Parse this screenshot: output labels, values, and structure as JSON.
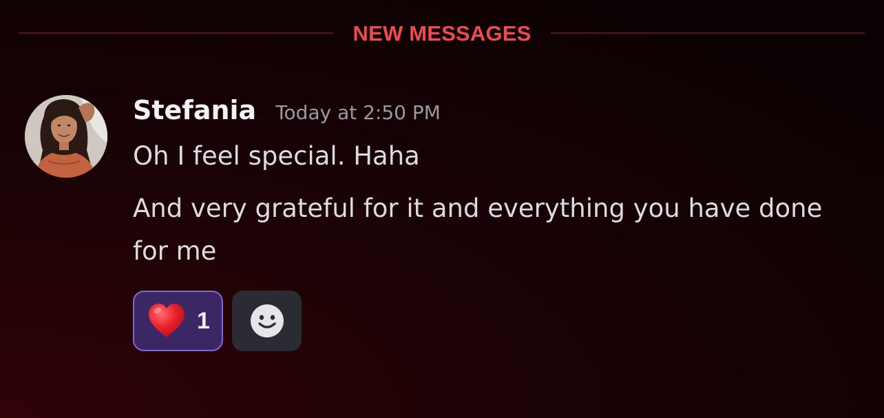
{
  "divider": {
    "label": "NEW MESSAGES"
  },
  "message": {
    "author": "Stefania",
    "timestamp": "Today at 2:50 PM",
    "avatar_icon": "user-avatar-photo",
    "lines": [
      "Oh I feel special. Haha",
      "And very grateful for it and everything you have done for me"
    ],
    "reactions": [
      {
        "icon": "red-heart-icon",
        "count": "1",
        "selected": true
      }
    ],
    "add_reaction_icon": "smiley-add-reaction-icon"
  },
  "colors": {
    "divider_text": "#ee4a4f",
    "divider_line": "#5a1319",
    "reaction_selected_bg": "#3b2763",
    "reaction_selected_border": "#7c6ad6",
    "add_reaction_bg": "#2a2b33"
  }
}
